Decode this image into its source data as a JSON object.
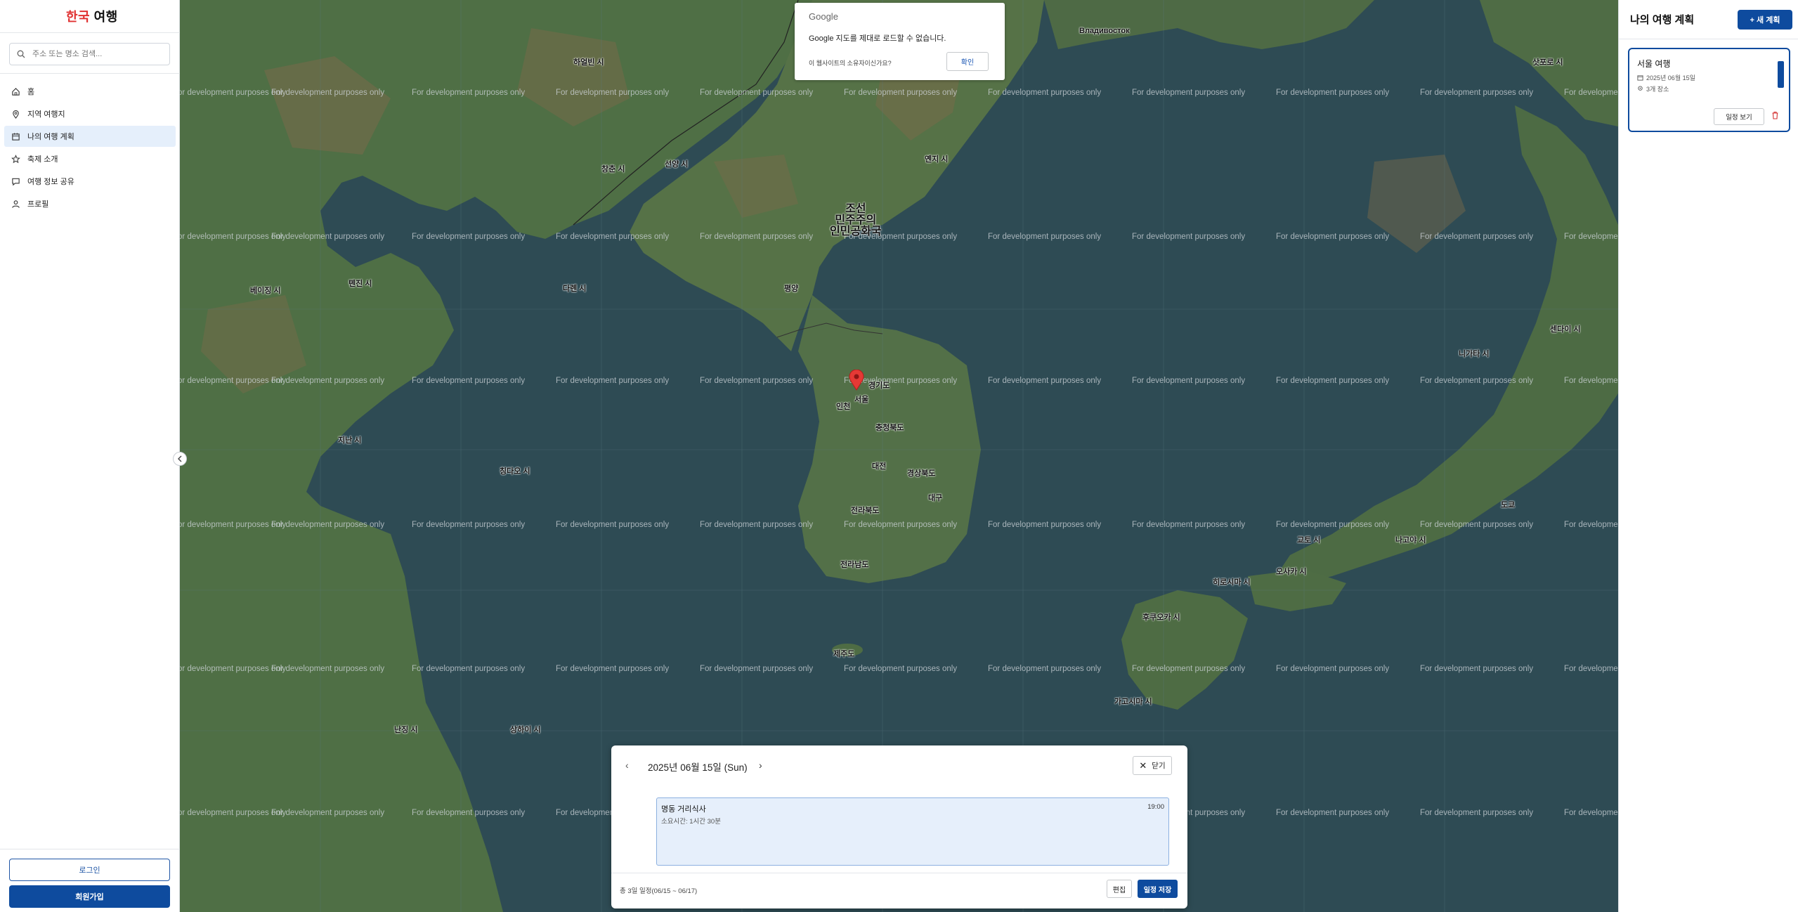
{
  "sidebar": {
    "logo_red": "한국",
    "logo_black": " 여행",
    "search_placeholder": "주소 또는 명소 검색...",
    "nav": [
      {
        "label": "홈",
        "icon": "home-icon"
      },
      {
        "label": "지역 여행지",
        "icon": "map-pin-icon"
      },
      {
        "label": "나의 여행 계획",
        "icon": "calendar-icon",
        "active": true
      },
      {
        "label": "축제 소개",
        "icon": "star-icon"
      },
      {
        "label": "여행 정보 공유",
        "icon": "chat-icon"
      },
      {
        "label": "프로필",
        "icon": "user-icon"
      }
    ],
    "login_label": "로그인",
    "signup_label": "회원가입"
  },
  "map": {
    "watermark": "For development purposes only",
    "labels": {
      "north_korea_1": "조선",
      "north_korea_2": "민주주의",
      "north_korea_3": "인민공화국",
      "vladivostok_ru": "Владивосток",
      "pyongyang": "평양",
      "seoul": "서울",
      "incheon": "인천",
      "daejeon": "대전",
      "daegu": "대구",
      "jeju": "제주도",
      "gyeonggi": "경기도",
      "chungbuk": "충청북도",
      "gyeongbuk": "경상북도",
      "jeonbuk": "전라북도",
      "jeonnam": "전라남도",
      "tianjin": "톈진 시",
      "beijing": "베이징 시",
      "dalian": "다롄 시",
      "qingdao": "칭다오 시",
      "shenyang": "선양 시",
      "jinan": "지난 시",
      "shanghai": "상하이 시",
      "nanjing": "난징 시",
      "osaka": "오사카 시",
      "kyoto": "교토 시",
      "fukuoka": "후쿠오카 시",
      "hiroshima": "히로시마 시",
      "tokyo": "도쿄",
      "sapporo": "삿포로 시",
      "sendai": "센다이 시",
      "niigata": "니가타 시",
      "nagoya": "나고야 시",
      "kagoshima": "가고시마 시",
      "changchun": "창춘 시",
      "harbin": "하얼빈 시",
      "yanji": "옌지 시"
    }
  },
  "google_dialog": {
    "title": "Google",
    "message": "Google 지도를 제대로 로드할 수 없습니다.",
    "question": "이 웹사이트의 소유자이신가요?",
    "ok_label": "확인"
  },
  "right_panel": {
    "title": "나의 여행 계획",
    "new_button": "+ 새 계획",
    "trip": {
      "title": "서울 여행",
      "date": "2025년 06월 15일",
      "places": "3개 장소",
      "view_label": "일정 보기"
    }
  },
  "schedule": {
    "prev": "‹",
    "date": "2025년 06월 15일 (Sun)",
    "next": "›",
    "close_label": "닫기",
    "event": {
      "name": "명동 거리식사",
      "duration": "소요시간: 1시간 30분",
      "time": "19:00"
    },
    "summary": "총 3일 일정(06/15 ~ 06/17)",
    "edit_label": "편집",
    "save_label": "일정 저장"
  },
  "colors": {
    "primary": "#0e4b9e",
    "logo_red": "#e03131",
    "marker": "#e53935",
    "sea": "#2e4b54",
    "land": "#4f6f45"
  }
}
